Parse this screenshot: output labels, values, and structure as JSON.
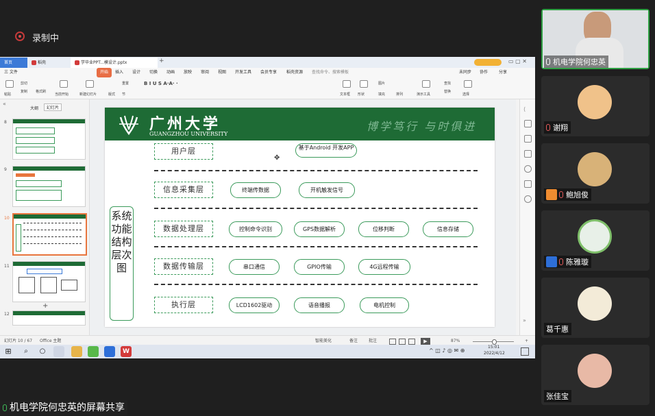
{
  "recording": {
    "label": "录制中"
  },
  "window": {
    "tabs": [
      {
        "label": "首页"
      },
      {
        "label": "稻壳"
      },
      {
        "label": "学毕业PPT...模设计.pptx"
      }
    ],
    "menu": [
      "三 文件",
      "开始",
      "插入",
      "设计",
      "切换",
      "动画",
      "放映",
      "审阅",
      "视图",
      "开发工具",
      "会员专享",
      "稻壳资源",
      "查找命令、搜索模板",
      "未同步",
      "协作",
      "分享"
    ],
    "toolbar": [
      "粘贴",
      "剪切",
      "复制",
      "格式刷",
      "当前开始",
      "新建幻灯片",
      "版式",
      "节",
      "重置",
      "文本框",
      "形状",
      "排列",
      "图片",
      "填充",
      "查找",
      "选择",
      "替换",
      "演示工具"
    ],
    "outline_tabs": {
      "outline": "大纲",
      "slides": "幻灯片"
    },
    "thumbnails": [
      {
        "num": "8"
      },
      {
        "num": "9"
      },
      {
        "num": "10"
      },
      {
        "num": "11"
      },
      {
        "num": "12"
      }
    ],
    "slide": {
      "university_cn": "广州大学",
      "university_en": "GUANGZHOU UNIVERSITY",
      "motto": "博学笃行  与时俱进",
      "side_title": "系统功能结构层次图",
      "layers": [
        {
          "name": "用户层",
          "items": [
            "基于Android 开发APP"
          ]
        },
        {
          "name": "信息采集层",
          "items": [
            "终端传数据",
            "开机触发信号"
          ]
        },
        {
          "name": "数据处理层",
          "items": [
            "控制命令识别",
            "GPS数据解析",
            "位移判断",
            "信息存储"
          ]
        },
        {
          "name": "数据传输层",
          "items": [
            "串口通信",
            "GPIO传输",
            "4G远程传输"
          ]
        },
        {
          "name": "执行层",
          "items": [
            "LCD1602驱动",
            "语音播报",
            "电机控制"
          ]
        }
      ]
    },
    "status": {
      "slide_counter": "幻灯片 10 / 67",
      "theme": "Office 主题",
      "smart": "智能美化",
      "notes": "备注",
      "comment": "批注",
      "zoom": "87%"
    },
    "taskbar": {
      "time": "15:01",
      "date": "2022/4/12"
    }
  },
  "participants": [
    {
      "name": "机电学院何忠英",
      "muted": false,
      "active": true
    },
    {
      "name": "谢翔",
      "muted": true
    },
    {
      "name": "鲍旭俊",
      "muted": true
    },
    {
      "name": "陈雅璇",
      "muted": true
    },
    {
      "name": "葛千惠",
      "muted": false
    },
    {
      "name": "张佳宝",
      "muted": false
    }
  ],
  "share_banner": {
    "label": "机电学院何忠英的屏幕共享"
  }
}
